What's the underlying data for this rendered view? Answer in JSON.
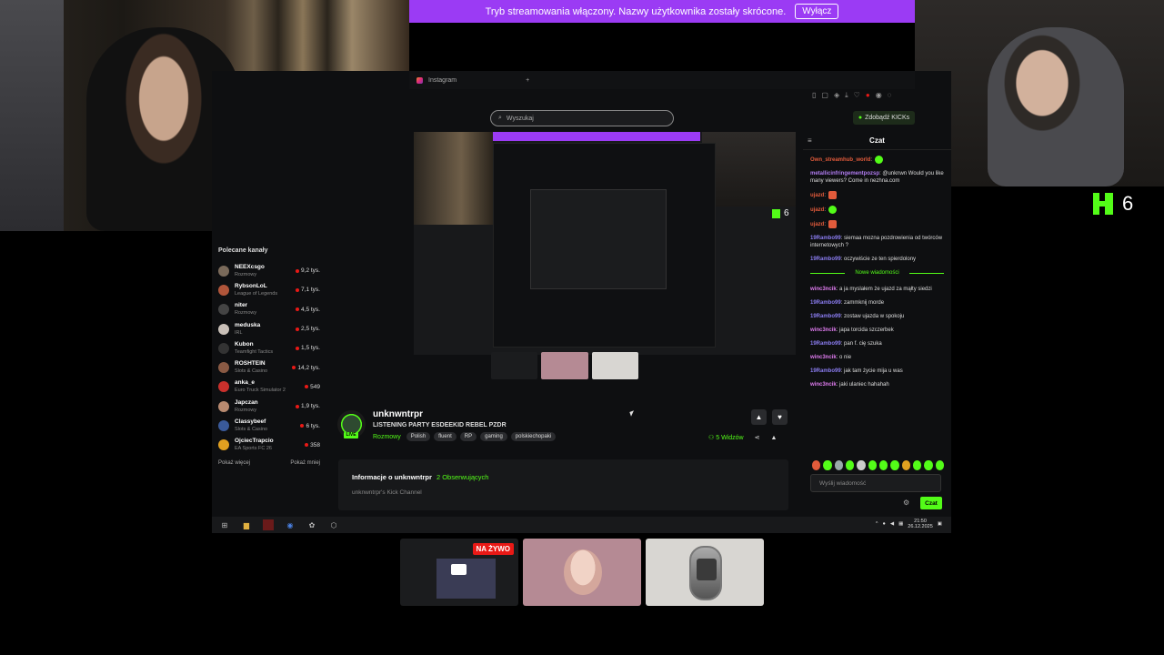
{
  "banner": {
    "text": "Tryb streamowania włączony. Nazwy użytkownika zostały skrócone.",
    "button": "Wyłącz"
  },
  "browser": {
    "tab_title": "Instagram",
    "new_tab": "+"
  },
  "search": {
    "placeholder": "Wyszukaj"
  },
  "header": {
    "get_kicks": "Zdobądź KICKs"
  },
  "kick_counter": {
    "value": "6"
  },
  "sidebar": {
    "title": "Polecane kanały",
    "items": [
      {
        "name": "NEEXcsgo",
        "category": "Rozmowy",
        "viewers": "9,2 tys.",
        "color": "#7a6a5a"
      },
      {
        "name": "RybsonLoL",
        "category": "League of Legends",
        "viewers": "7,1 tys.",
        "color": "#b0553a"
      },
      {
        "name": "niter",
        "category": "Rozmowy",
        "viewers": "4,5 tys.",
        "color": "#444444"
      },
      {
        "name": "meduska",
        "category": "IRL",
        "viewers": "2,5 tys.",
        "color": "#c9c0b8"
      },
      {
        "name": "Kubon",
        "category": "Teamfight Tactics",
        "viewers": "1,5 tys.",
        "color": "#333333"
      },
      {
        "name": "ROSHTEIN",
        "category": "Slots & Casino",
        "viewers": "14,2 tys.",
        "color": "#8a5a44"
      },
      {
        "name": "anka_e",
        "category": "Euro Truck Simulator 2",
        "viewers": "549",
        "color": "#c9302c"
      },
      {
        "name": "Japczan",
        "category": "Rozmowy",
        "viewers": "1,9 tys.",
        "color": "#b88a70"
      },
      {
        "name": "Classybeef",
        "category": "Slots & Casino",
        "viewers": "6 tys.",
        "color": "#3a5a9a"
      },
      {
        "name": "OjciecTrapcio",
        "category": "EA Sports FC 26",
        "viewers": "358",
        "color": "#e0a020"
      }
    ],
    "show_more": "Pokaż więcej",
    "show_less": "Pokaż mniej"
  },
  "channel": {
    "name": "unknwntrpr",
    "title": "LISTENING PARTY ESDEEKID REBEL PZDR",
    "category": "Rozmowy",
    "tags": [
      "Polish",
      "fluent",
      "RP",
      "gaming",
      "polskiechopaki"
    ],
    "live": "LIVE",
    "viewers": "5 Widzów",
    "about_title": "Informacje o unknwntrpr",
    "followers": "2 Obserwujących",
    "description": "unknwntrpr's Kick Channel"
  },
  "chat": {
    "title": "Czat",
    "messages": [
      {
        "user": "Own_streamhub_world",
        "text": ":",
        "color": "#e25b3b",
        "emote": "g"
      },
      {
        "user": "metallicinfringementpozsp",
        "text": ": @unknwn Would you like many viewers? Come in nezhna.com",
        "color": "#b07cf0"
      },
      {
        "user": "ujazd",
        "text": ":",
        "color": "#e25b3b",
        "emote": "r"
      },
      {
        "user": "ujazd",
        "text": ":",
        "color": "#e25b3b",
        "emote": "g"
      },
      {
        "user": "ujazd",
        "text": ":",
        "color": "#e25b3b",
        "emote": "r"
      },
      {
        "user": "19Rambo99",
        "text": ": siemaa mozna pozdrowienia od twórców internetowych ?",
        "color": "#8a7cf0"
      },
      {
        "user": "19Rambo99",
        "text": ": oczywiście ze ten spierdolony",
        "color": "#8a7cf0"
      }
    ],
    "new_messages": "Nowe wiadomości",
    "new": [
      {
        "user": "winc3ncik",
        "text": ": a ja myslałem że ujazd za mąłty siedzi",
        "color": "#e07cf0"
      },
      {
        "user": "19Rambo99",
        "text": ": zammknij morde",
        "color": "#8a7cf0"
      },
      {
        "user": "19Rambo99",
        "text": ": zostaw ujazda w spokoju",
        "color": "#8a7cf0"
      },
      {
        "user": "winc3ncik",
        "text": ": japa torcida szczerbek",
        "color": "#e07cf0"
      },
      {
        "user": "19Rambo99",
        "text": ": pan f. cię szuka",
        "color": "#8a7cf0"
      },
      {
        "user": "winc3ncik",
        "text": ": o nie",
        "color": "#e07cf0"
      },
      {
        "user": "19Rambo99",
        "text": ": jak tam życie mija u was",
        "color": "#8a7cf0"
      },
      {
        "user": "winc3ncik",
        "text": ": jaki ulaniec hahahah",
        "color": "#e07cf0"
      }
    ],
    "input_placeholder": "Wyślij wiadomość",
    "send": "Czat"
  },
  "taskbar": {
    "time": "21:50",
    "date": "26.12.2025"
  },
  "tiles": {
    "live_badge": "NA ŻYWO"
  },
  "colors": {
    "accent": "#53fc18",
    "banner": "#9b3bf4",
    "live": "#e91916"
  }
}
